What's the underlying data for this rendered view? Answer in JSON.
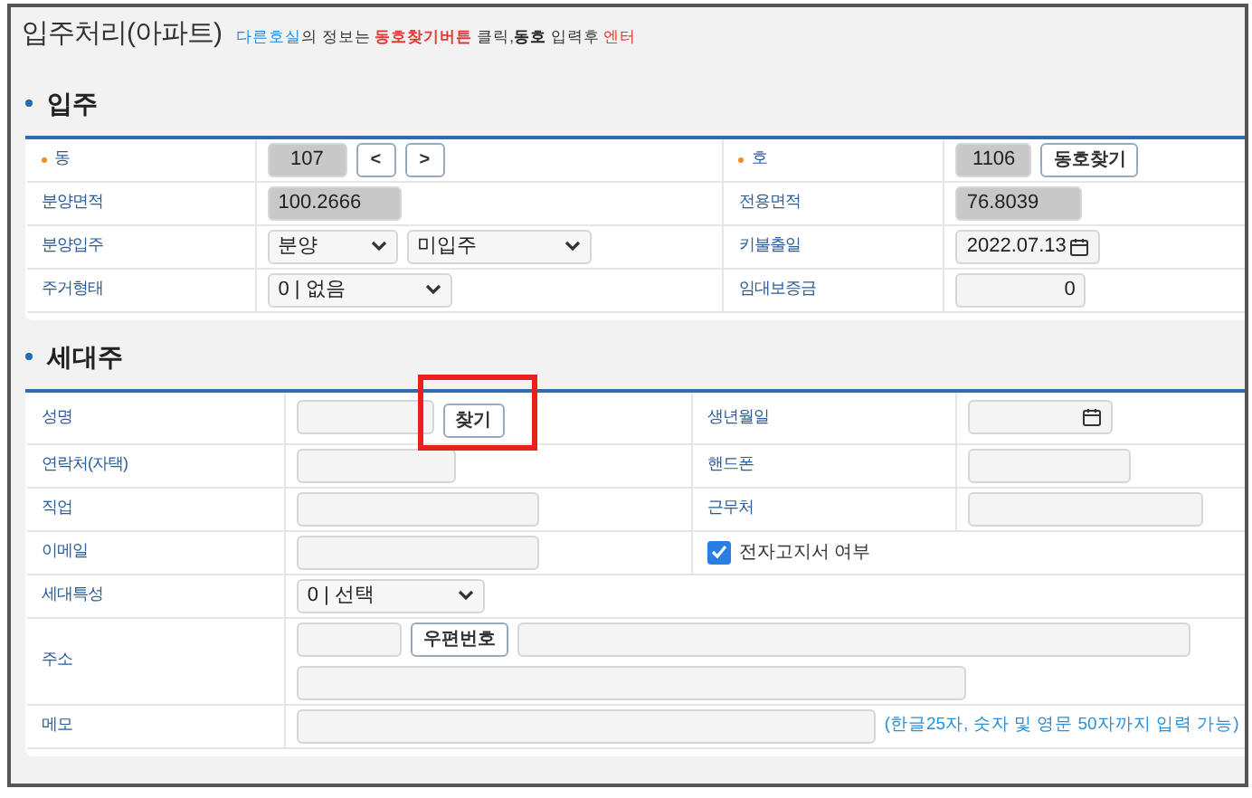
{
  "title": "입주처리(아파트)",
  "notice": [
    {
      "text": "다른호실",
      "color": "#1e88e5",
      "bold": false
    },
    {
      "text": "의 정보는 ",
      "color": "#333333",
      "bold": false
    },
    {
      "text": "동호찾기버튼",
      "color": "#e53935",
      "bold": true
    },
    {
      "text": " 클릭,",
      "color": "#333333",
      "bold": false
    },
    {
      "text": "동호",
      "color": "#222222",
      "bold": true
    },
    {
      "text": " 입력후 ",
      "color": "#333333",
      "bold": false
    },
    {
      "text": "엔터",
      "color": "#e53935",
      "bold": false
    }
  ],
  "sections": [
    {
      "heading": "입주",
      "rows": [
        {
          "cells": [
            {
              "label": "동",
              "required": true,
              "controls": [
                {
                  "kind": "text",
                  "value": "107",
                  "disabled": true
                },
                {
                  "kind": "button",
                  "label": "<",
                  "highlighted": false
                },
                {
                  "kind": "button",
                  "label": ">",
                  "highlighted": false
                }
              ]
            },
            {
              "label": "호",
              "required": true,
              "controls": [
                {
                  "kind": "text",
                  "value": "1106",
                  "disabled": true
                },
                {
                  "kind": "button",
                  "label": "동호찾기",
                  "highlighted": false
                }
              ]
            }
          ]
        },
        {
          "cells": [
            {
              "label": "분양면적",
              "required": false,
              "controls": [
                {
                  "kind": "text",
                  "value": "100.2666",
                  "disabled": true
                }
              ]
            },
            {
              "label": "전용면적",
              "required": false,
              "controls": [
                {
                  "kind": "text",
                  "value": "76.8039",
                  "disabled": true
                }
              ]
            }
          ]
        },
        {
          "cells": [
            {
              "label": "분양입주",
              "required": false,
              "controls": [
                {
                  "kind": "select",
                  "value": "분양"
                },
                {
                  "kind": "select",
                  "value": "미입주"
                }
              ]
            },
            {
              "label": "키불출일",
              "required": false,
              "controls": [
                {
                  "kind": "date",
                  "value": "2022.07.13"
                }
              ]
            }
          ]
        },
        {
          "cells": [
            {
              "label": "주거형태",
              "required": false,
              "controls": [
                {
                  "kind": "select",
                  "value": "0 | 없음"
                }
              ]
            },
            {
              "label": "임대보증금",
              "required": false,
              "controls": [
                {
                  "kind": "text",
                  "value": "0",
                  "disabled": false
                }
              ]
            }
          ]
        }
      ]
    },
    {
      "heading": "세대주",
      "rows": [
        {
          "cells": [
            {
              "label": "성명",
              "required": false,
              "controls": [
                {
                  "kind": "text",
                  "disabled": false
                },
                {
                  "kind": "button",
                  "label": "찾기",
                  "highlighted": true
                }
              ]
            },
            {
              "label": "생년월일",
              "required": false,
              "controls": [
                {
                  "kind": "date"
                }
              ]
            }
          ]
        },
        {
          "cells": [
            {
              "label": "연락처(자택)",
              "required": false,
              "controls": [
                {
                  "kind": "text",
                  "disabled": false
                }
              ]
            },
            {
              "label": "핸드폰",
              "required": false,
              "controls": [
                {
                  "kind": "text",
                  "disabled": false
                }
              ]
            }
          ]
        },
        {
          "cells": [
            {
              "label": "직업",
              "required": false,
              "controls": [
                {
                  "kind": "text",
                  "disabled": false
                }
              ]
            },
            {
              "label": "근무처",
              "required": false,
              "controls": [
                {
                  "kind": "text",
                  "disabled": false
                }
              ]
            }
          ]
        },
        {
          "cells": [
            {
              "label": "이메일",
              "required": false,
              "controls": [
                {
                  "kind": "text",
                  "disabled": false
                }
              ]
            },
            {
              "controls": [
                {
                  "kind": "checkbox",
                  "label": "전자고지서 여부",
                  "checked": true
                }
              ]
            }
          ]
        },
        {
          "cells": [
            {
              "label": "세대특성",
              "required": false,
              "controls": [
                {
                  "kind": "select",
                  "value": "0 | 선택"
                }
              ]
            }
          ]
        },
        {
          "cells": [
            {
              "label": "주소",
              "required": false,
              "lines": [
                [
                  {
                    "kind": "text",
                    "disabled": false
                  },
                  {
                    "kind": "button",
                    "label": "우편번호",
                    "highlighted": false
                  },
                  {
                    "kind": "text",
                    "disabled": false
                  }
                ],
                [
                  {
                    "kind": "text",
                    "disabled": false
                  }
                ]
              ]
            }
          ]
        },
        {
          "cells": [
            {
              "label": "메모",
              "required": false,
              "controls": [
                {
                  "kind": "text",
                  "disabled": false
                },
                {
                  "kind": "hint",
                  "text": "(한글25자, 숫자 및 영문 50자까지 입력 가능)"
                }
              ]
            }
          ]
        }
      ]
    }
  ]
}
